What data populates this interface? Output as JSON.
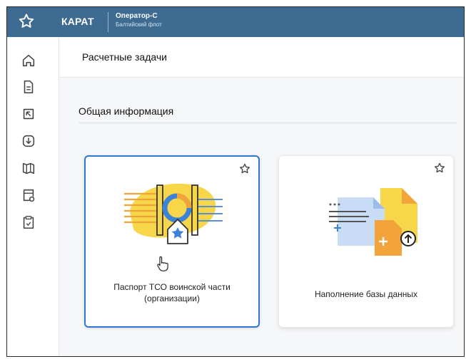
{
  "topbar": {
    "app_name": "КАРАТ",
    "user_name": "Оператор-С",
    "organization": "Балтийский флот"
  },
  "sidebar": {
    "items": [
      {
        "icon": "home-icon"
      },
      {
        "icon": "document-icon"
      },
      {
        "icon": "tasks-icon"
      },
      {
        "icon": "import-icon"
      },
      {
        "icon": "book-icon"
      },
      {
        "icon": "database-settings-icon"
      },
      {
        "icon": "clipboard-icon"
      }
    ]
  },
  "header": {
    "title": "Расчетные задачи"
  },
  "section": {
    "title": "Общая информация"
  },
  "cards": [
    {
      "label": "Паспорт ТСО воинской части (организации)",
      "selected": true
    },
    {
      "label": "Наполнение базы данных",
      "selected": false
    }
  ],
  "colors": {
    "topbar": "#3e6b92",
    "selected_border": "#2f76d2",
    "accent_yellow": "#f7d64a",
    "accent_orange": "#f2a33a",
    "accent_blue": "#3c82d8"
  }
}
